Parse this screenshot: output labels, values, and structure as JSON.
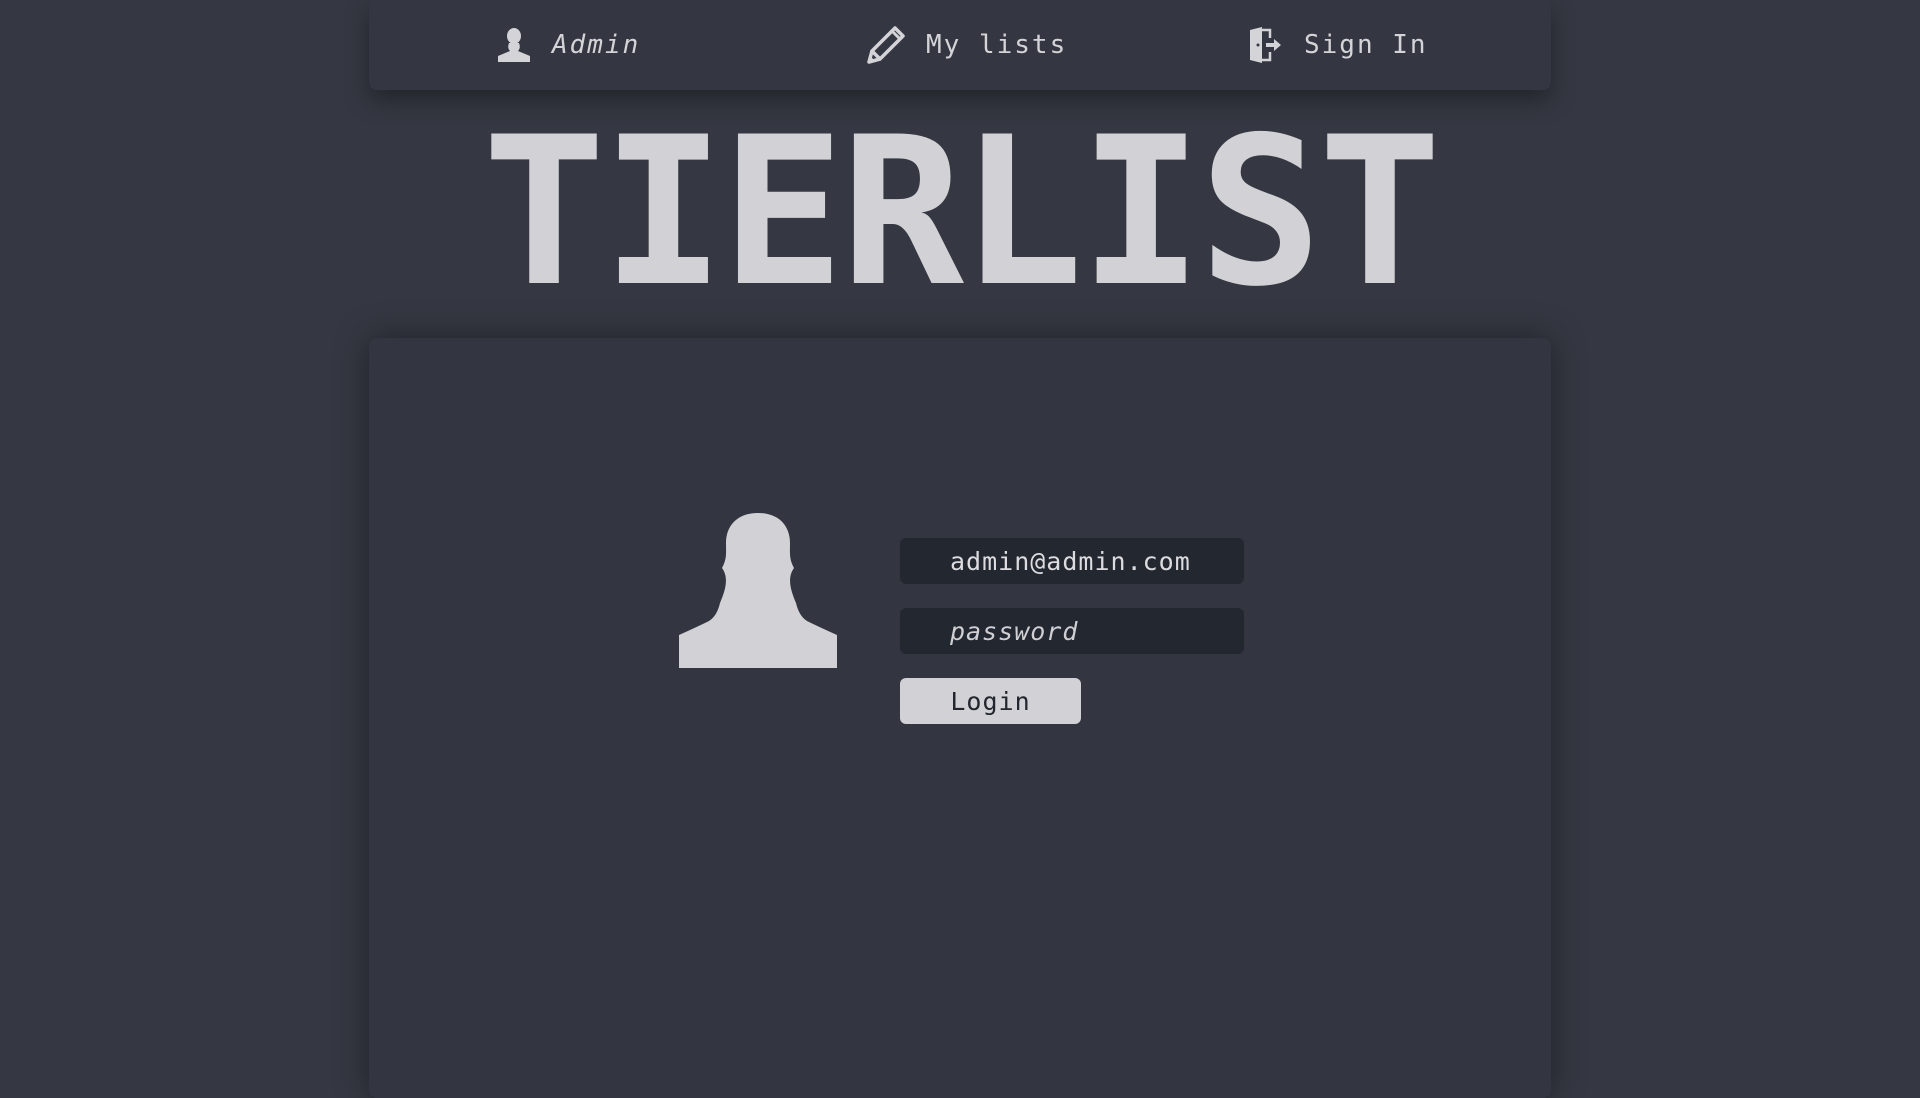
{
  "nav": {
    "items": [
      {
        "label": "Admin",
        "icon": "user-icon"
      },
      {
        "label": "My lists",
        "icon": "pencil-icon"
      },
      {
        "label": "Sign In",
        "icon": "sign-in-icon"
      }
    ]
  },
  "title": "TIERLIST",
  "login": {
    "avatar_icon": "user-avatar-icon",
    "email_value": "admin@admin.com",
    "password_placeholder": "password",
    "button_label": "Login"
  },
  "colors": {
    "background": "#353842",
    "panel": "#333640",
    "input": "#23272f",
    "text": "#d2d2d6"
  }
}
